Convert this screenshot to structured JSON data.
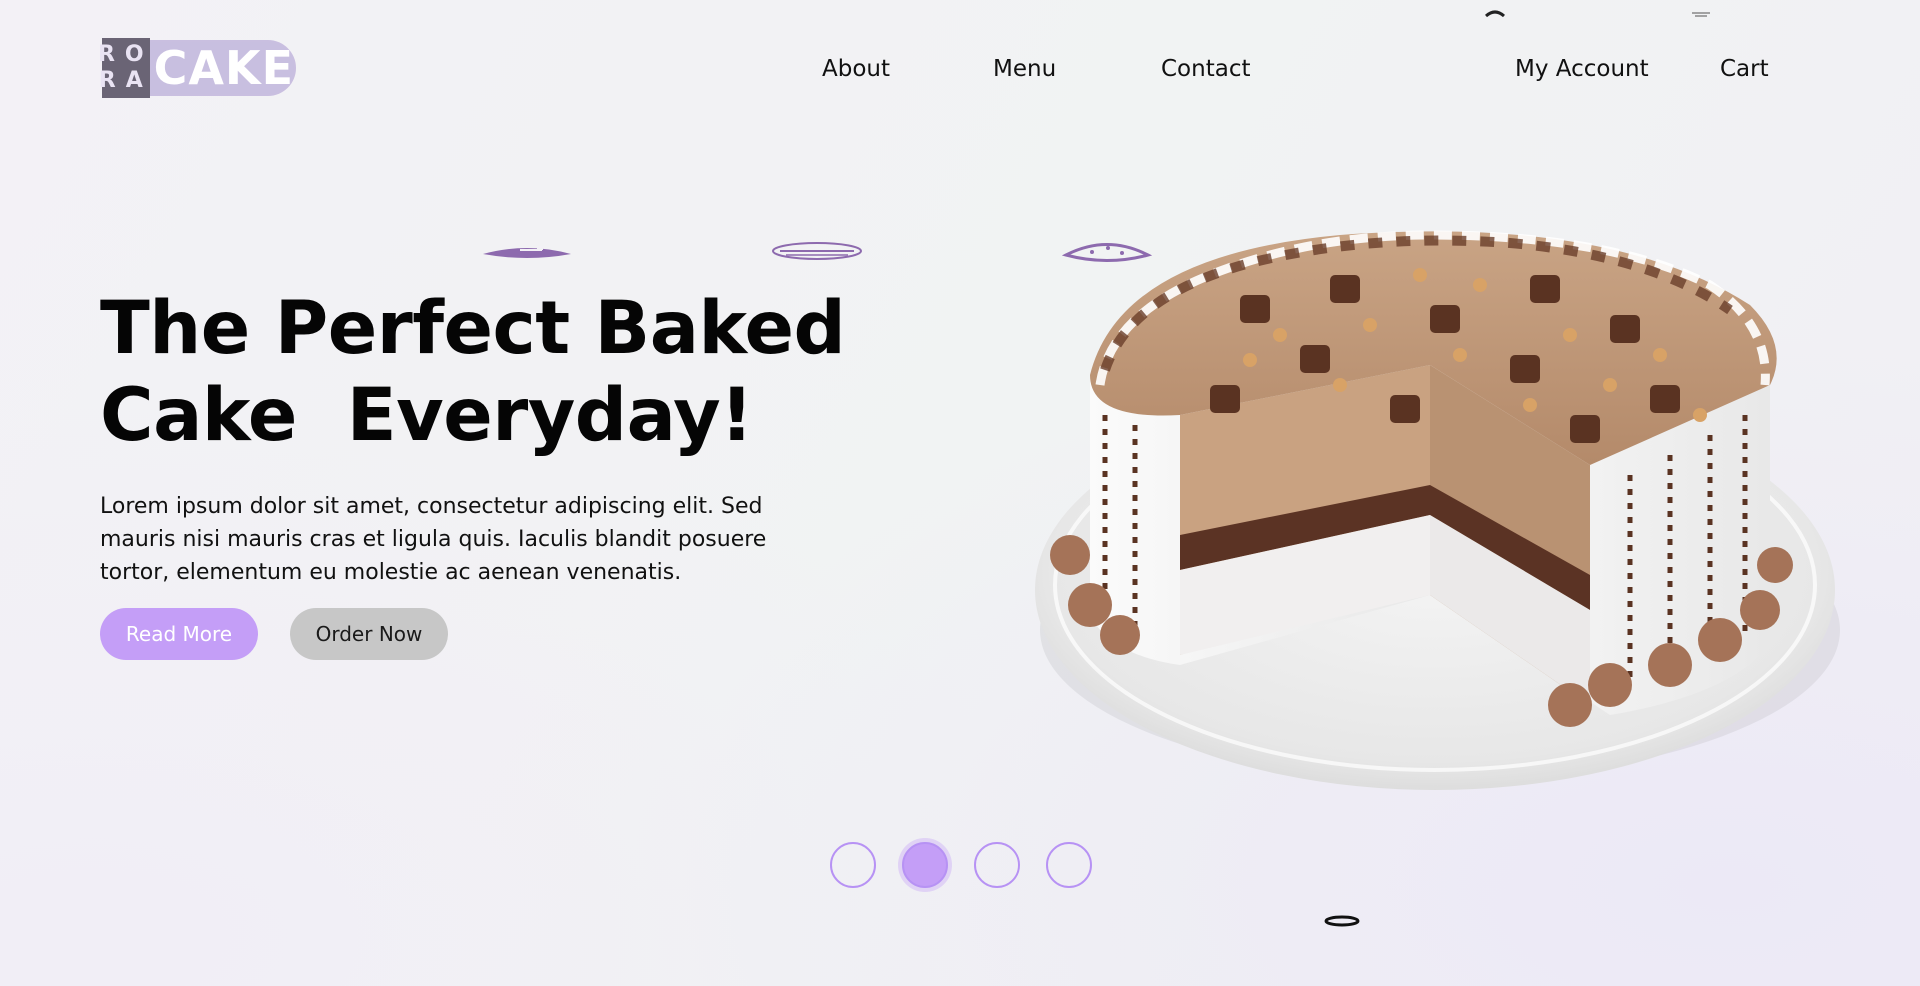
{
  "brand": {
    "logo_letters": [
      "RO",
      "RA"
    ],
    "logo_word": "CAKE",
    "accent_color": "#c49ef7"
  },
  "nav": {
    "about": "About",
    "menu": "Menu",
    "contact": "Contact",
    "account": "My Account",
    "cart": "Cart"
  },
  "hero": {
    "title_line1": "The Perfect Baked",
    "title_line2": "Cake  Everyday!",
    "description": "Lorem ipsum dolor sit amet, consectetur adipiscing elit. Sed mauris nisi mauris cras et ligula quis. Iaculis blandit posuere tortor, elementum eu molestie ac aenean venenatis.",
    "read_more": "Read More",
    "order_now": "Order Now"
  },
  "decorative_icons": [
    "cake-slice-icon",
    "macaron-icon",
    "cookie-icon",
    "donut-icon"
  ],
  "carousel": {
    "slides": 4,
    "active_index": 1
  }
}
